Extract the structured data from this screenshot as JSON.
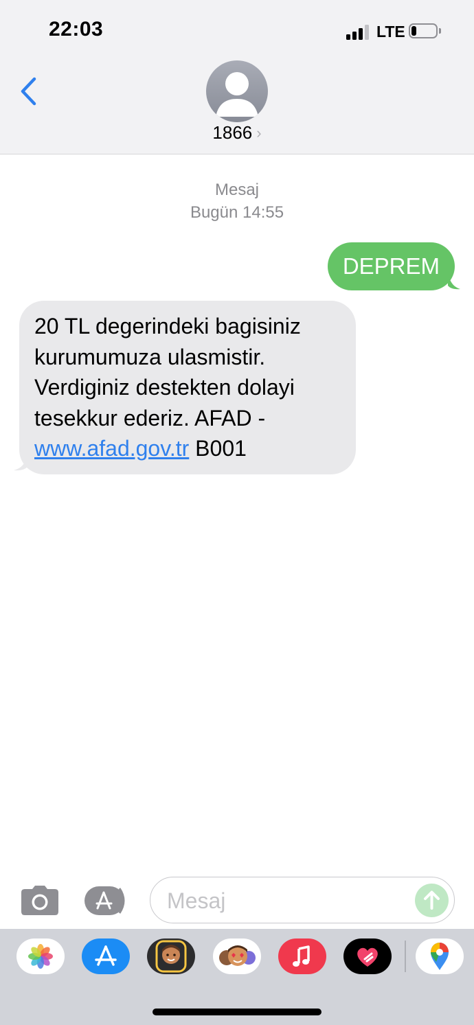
{
  "status_bar": {
    "time": "22:03",
    "network": "LTE",
    "battery_level": 0.2
  },
  "header": {
    "contact_name": "1866",
    "icons": {
      "back": "chevron-left-icon",
      "avatar": "person-icon",
      "disclosure": "chevron-right-icon"
    }
  },
  "conversation": {
    "service_label": "Mesaj",
    "timestamp": "Bugün 14:55",
    "messages": [
      {
        "direction": "outgoing",
        "text": "DEPREM"
      },
      {
        "direction": "incoming",
        "text_before_link": "20 TL degerindeki bagisiniz kurumumuza ulasmistir. Verdiginiz destekten dolayi tesekkur ederiz. AFAD - ",
        "link": "www.afad.gov.tr",
        "text_after_link": " B001"
      }
    ]
  },
  "composer": {
    "placeholder": "Mesaj",
    "icons": {
      "camera": "camera-icon",
      "apps": "app-store-icon",
      "send": "send-arrow-icon"
    }
  },
  "app_drawer": {
    "apps": [
      "photos-app-icon",
      "app-store-app-icon",
      "memoji-app-icon",
      "animoji-stickers-app-icon",
      "music-app-icon",
      "digital-touch-app-icon",
      "google-maps-app-icon"
    ]
  },
  "colors": {
    "ios_blue": "#2f80ed",
    "imessage_sms_green": "#65c466",
    "incoming_bubble": "#e9e9eb",
    "header_bg": "#f2f2f4",
    "drawer_bg": "#d1d3d9"
  }
}
